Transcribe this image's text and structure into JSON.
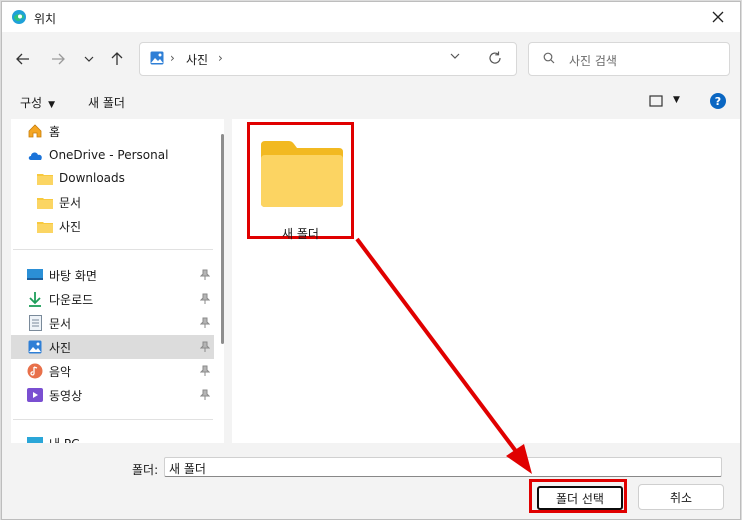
{
  "window": {
    "title": "위치"
  },
  "address": {
    "crumb": "사진",
    "sep": "›"
  },
  "search": {
    "placeholder": "사진 검색"
  },
  "toolbar": {
    "organize": "구성",
    "new_folder": "새 폴더"
  },
  "sidebar": {
    "items": [
      {
        "label": "홈",
        "icon": "home-icon"
      },
      {
        "label": "OneDrive - Personal",
        "icon": "cloud-icon"
      },
      {
        "label": "Downloads",
        "icon": "folder-icon"
      },
      {
        "label": "문서",
        "icon": "folder-icon"
      },
      {
        "label": "사진",
        "icon": "folder-icon"
      },
      {
        "label": "바탕 화면",
        "icon": "desktop-icon",
        "pinned": true
      },
      {
        "label": "다운로드",
        "icon": "download-icon",
        "pinned": true
      },
      {
        "label": "문서",
        "icon": "document-icon",
        "pinned": true
      },
      {
        "label": "사진",
        "icon": "pictures-icon",
        "pinned": true,
        "selected": true
      },
      {
        "label": "음악",
        "icon": "music-icon",
        "pinned": true
      },
      {
        "label": "동영상",
        "icon": "video-icon",
        "pinned": true
      },
      {
        "label": "내 PC",
        "icon": "computer-icon"
      }
    ]
  },
  "content": {
    "folder_name": "새 폴더"
  },
  "footer": {
    "folder_label": "폴더:",
    "folder_value": "새 폴더",
    "select_button": "폴더 선택",
    "cancel_button": "취소"
  },
  "colors": {
    "highlight": "#e00000",
    "accent": "#0a66c2",
    "folder": "#f8c93e"
  }
}
